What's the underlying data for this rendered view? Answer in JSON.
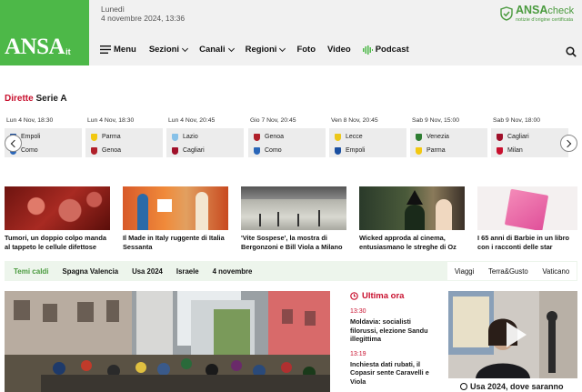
{
  "header": {
    "logo": "ANSA",
    "logo_suffix": "it",
    "day": "Lunedì",
    "date": "4 novembre 2024, 13:36",
    "check_title": "ANSA",
    "check_title_suffix": "check",
    "check_subtitle": "notizie d'origine certificata"
  },
  "nav": {
    "menu": "Menu",
    "items": [
      "Sezioni",
      "Canali",
      "Regioni",
      "Foto",
      "Video",
      "Podcast"
    ]
  },
  "dirette": {
    "title_red": "Dirette",
    "title_black": "Serie A",
    "matches": [
      {
        "date": "Lun 4 Nov, 18:30",
        "home": "Empoli",
        "away": "Como",
        "hc": "#1a4fa0",
        "ac": "#2a66b8"
      },
      {
        "date": "Lun 4 Nov, 18:30",
        "home": "Parma",
        "away": "Genoa",
        "hc": "#f2c811",
        "ac": "#b0202a"
      },
      {
        "date": "Lun 4 Nov, 20:45",
        "home": "Lazio",
        "away": "Cagliari",
        "hc": "#87c1e8",
        "ac": "#a0102a"
      },
      {
        "date": "Gio 7 Nov, 20:45",
        "home": "Genoa",
        "away": "Como",
        "hc": "#b0202a",
        "ac": "#2a66b8"
      },
      {
        "date": "Ven 8 Nov, 20:45",
        "home": "Lecce",
        "away": "Empoli",
        "hc": "#ecc71a",
        "ac": "#1a4fa0"
      },
      {
        "date": "Sab 9 Nov, 15:00",
        "home": "Venezia",
        "away": "Parma",
        "hc": "#2e7d32",
        "ac": "#f2c811"
      },
      {
        "date": "Sab 9 Nov, 18:00",
        "home": "Cagliari",
        "away": "Milan",
        "hc": "#a0102a",
        "ac": "#c8102e"
      }
    ]
  },
  "news": [
    {
      "caption": "Tumori, un doppio colpo manda al tappeto le cellule difettose"
    },
    {
      "caption": "Il Made in Italy ruggente di Italia Sessanta"
    },
    {
      "caption": "'Vite Sospese', la mostra di Bergonzoni e Bill Viola a Milano"
    },
    {
      "caption": "Wicked approda al cinema, entusiasmano le streghe di Oz"
    },
    {
      "caption": "I 65 anni di Barbie in un libro con i racconti delle star"
    }
  ],
  "temi": {
    "label": "Temi caldi",
    "tags": [
      "Spagna Valencia",
      "Usa 2024",
      "Israele",
      "4 novembre"
    ],
    "right": [
      "Viaggi",
      "Terra&Gusto",
      "Vaticano"
    ]
  },
  "ultima_ora": {
    "title": "Ultima ora",
    "items": [
      {
        "time": "13:30",
        "text": "Moldavia: socialisti filorussi, elezione Sandu illegittima"
      },
      {
        "time": "13:19",
        "text": "Inchiesta dati rubati, il Copasir sente Caravelli e Viola"
      }
    ]
  },
  "video": {
    "caption": "Usa 2024, dove saranno"
  }
}
